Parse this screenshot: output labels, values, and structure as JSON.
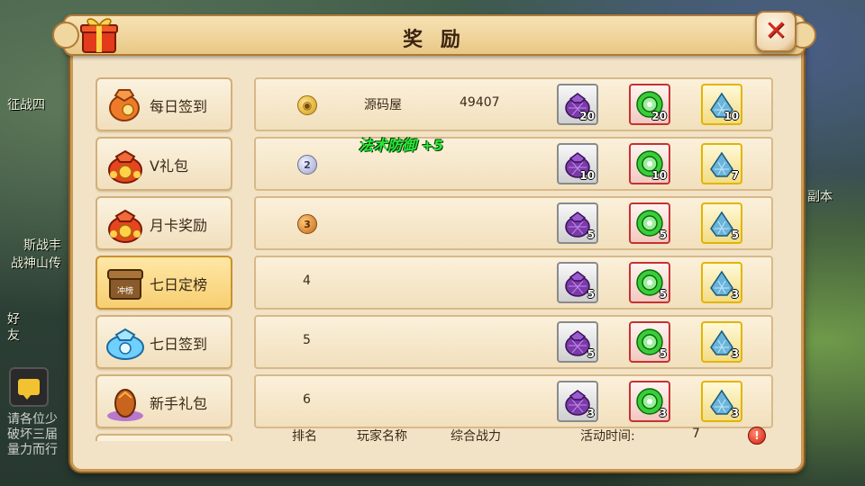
{
  "title": "奖 励",
  "scene": {
    "text_left_1": "征战四",
    "text_left_2": "斯战丰",
    "text_left_3": "战神山传",
    "text_left_4": "好友",
    "text_right": "副本",
    "chat_log": "请各位少破坏三届量力而行"
  },
  "sidebar": {
    "items": [
      {
        "label": "每日签到",
        "icon": "orange-pouch-icon"
      },
      {
        "label": "V礼包",
        "icon": "red-gift-bag-icon"
      },
      {
        "label": "月卡奖励",
        "icon": "red-gift-bag-icon"
      },
      {
        "label": "七日定榜",
        "icon": "chest-rank-icon",
        "icon_text": "冲榜"
      },
      {
        "label": "七日签到",
        "icon": "blue-pouch-icon"
      },
      {
        "label": "新手礼包",
        "icon": "dragon-egg-icon"
      }
    ]
  },
  "rows": [
    {
      "rank": "1",
      "medal": "gold",
      "player": "源码屋",
      "power": "49407",
      "q1": "20",
      "q2": "20",
      "q3": "10"
    },
    {
      "rank": "2",
      "medal": "silver",
      "player": "",
      "power": "",
      "q1": "10",
      "q2": "10",
      "q3": "7"
    },
    {
      "rank": "3",
      "medal": "bronze",
      "player": "",
      "power": "",
      "q1": "5",
      "q2": "5",
      "q3": "5"
    },
    {
      "rank": "4",
      "medal": "",
      "player": "",
      "power": "",
      "q1": "5",
      "q2": "5",
      "q3": "3"
    },
    {
      "rank": "5",
      "medal": "",
      "player": "",
      "power": "",
      "q1": "5",
      "q2": "5",
      "q3": "3"
    },
    {
      "rank": "6",
      "medal": "",
      "player": "",
      "power": "",
      "q1": "3",
      "q2": "3",
      "q3": "3"
    }
  ],
  "medal_text": {
    "silver": "2",
    "bronze": "3"
  },
  "float_text": "法术防御 +5",
  "footer": {
    "col_rank": "排名",
    "col_player": "玩家名称",
    "col_power": "综合战力",
    "activity_label": "活动时间:",
    "activity_value": "7"
  },
  "colors": {
    "slot_grey": "#8a8a8a",
    "slot_red": "#c43232",
    "slot_gold": "#e3b400"
  }
}
